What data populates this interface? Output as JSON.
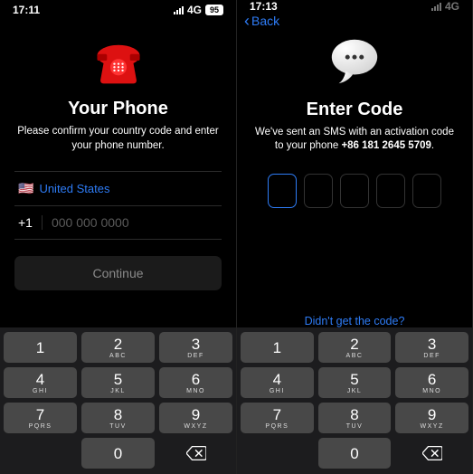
{
  "screens": [
    {
      "status": {
        "time": "17:11",
        "network": "4G",
        "battery": "95",
        "dimmed": false
      },
      "title": "Your Phone",
      "subtitle": "Please confirm your country code and enter your phone number.",
      "country": {
        "flag": "🇺🇸",
        "name": "United States",
        "dial": "+1"
      },
      "phone_placeholder": "000 000 0000",
      "continue_label": "Continue"
    },
    {
      "status": {
        "time": "17:13",
        "network": "4G",
        "battery": "",
        "dimmed": true
      },
      "back_label": "Back",
      "title": "Enter Code",
      "subtitle_prefix": "We've sent an SMS with an activation code to your phone ",
      "subtitle_phone": "+86 181 2645 5709",
      "code_length": 5,
      "resend_label": "Didn't get the code?"
    }
  ],
  "keypad": [
    {
      "digit": "1",
      "letters": ""
    },
    {
      "digit": "2",
      "letters": "ABC"
    },
    {
      "digit": "3",
      "letters": "DEF"
    },
    {
      "digit": "4",
      "letters": "GHI"
    },
    {
      "digit": "5",
      "letters": "JKL"
    },
    {
      "digit": "6",
      "letters": "MNO"
    },
    {
      "digit": "7",
      "letters": "PQRS"
    },
    {
      "digit": "8",
      "letters": "TUV"
    },
    {
      "digit": "9",
      "letters": "WXYZ"
    },
    {
      "digit": "",
      "letters": "",
      "blank": true
    },
    {
      "digit": "0",
      "letters": ""
    },
    {
      "digit": "",
      "letters": "",
      "backspace": true
    }
  ]
}
